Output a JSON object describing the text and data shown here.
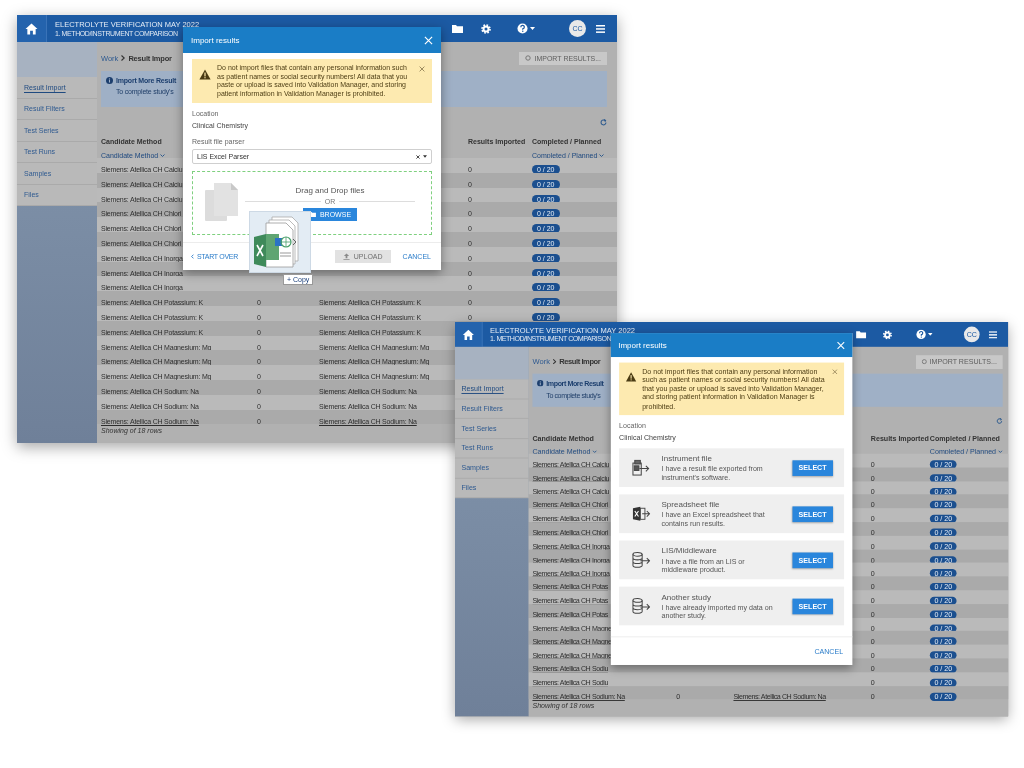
{
  "windows": [
    {
      "header": {
        "title": "ELECTROLYTE VERIFICATION MAY 2022",
        "subtitle": "1. METHOD/INSTRUMENT COMPARISON",
        "avatar": "CC"
      },
      "sidebar": [
        {
          "label": "Result Import",
          "selected": true
        },
        {
          "label": "Result Filters",
          "selected": false
        },
        {
          "label": "Test Series",
          "selected": false
        },
        {
          "label": "Test Runs",
          "selected": false
        },
        {
          "label": "Samples",
          "selected": false
        },
        {
          "label": "Files",
          "selected": false
        }
      ],
      "breadcrumb": {
        "parent": "Work",
        "current": "Result Impor"
      },
      "action_button": "IMPORT RESULTS...",
      "notice": {
        "title": "Import More Result",
        "text": "To complete study's"
      },
      "table": {
        "columns": {
          "column_1": {
            "label": "Candidate Method",
            "filter": "Candidate Method"
          },
          "column_4": {
            "label": "Results Imported"
          },
          "column_5": {
            "label": "Completed / Planned",
            "filter": "Completed / Planned"
          }
        },
        "rows": [
          {
            "column_1": "Siemens: Atellica CH Calciu",
            "column_4": "0",
            "column_5": "0 / 20"
          },
          {
            "column_1": "Siemens: Atellica CH Calciu",
            "column_4": "0",
            "column_5": "0 / 20"
          },
          {
            "column_1": "Siemens: Atellica CH Calciu",
            "column_4": "0",
            "column_5": "0 / 20"
          },
          {
            "column_1": "Siemens: Atellica CH Chlori",
            "column_4": "0",
            "column_5": "0 / 20"
          },
          {
            "column_1": "Siemens: Atellica CH Chlori",
            "column_4": "0",
            "column_5": "0 / 20"
          },
          {
            "column_1": "Siemens: Atellica CH Chlori",
            "column_4": "0",
            "column_5": "0 / 20"
          },
          {
            "column_1": "Siemens: Atellica CH Inorga",
            "column_4": "0",
            "column_5": "0 / 20"
          },
          {
            "column_1": "Siemens: Atellica CH Inorga",
            "column_4": "0",
            "column_5": "0 / 20"
          },
          {
            "column_1": "Siemens: Atellica CH Inorga",
            "column_4": "0",
            "column_5": "0 / 20"
          },
          {
            "column_1": "Siemens: Atellica CH Potassium: K",
            "column_2": "0",
            "column_3": "Siemens: Atellica CH Potassium: K",
            "column_4": "0",
            "column_5": "0 / 20"
          },
          {
            "column_1": "Siemens: Atellica CH Potassium: K",
            "column_2": "0",
            "column_3": "Siemens: Atellica CH Potassium: K",
            "column_4": "0",
            "column_5": "0 / 20"
          },
          {
            "column_1": "Siemens: Atellica CH Potassium: K",
            "column_2": "0",
            "column_3": "Siemens: Atellica CH Potassium: K"
          },
          {
            "column_1": "Siemens: Atellica CH Magnesium: Mg",
            "column_2": "0",
            "column_3": "Siemens: Atellica CH Magnesium: Mg"
          },
          {
            "column_1": "Siemens: Atellica CH Magnesium: Mg",
            "column_2": "0",
            "column_3": "Siemens: Atellica CH Magnesium: Mg"
          },
          {
            "column_1": "Siemens: Atellica CH Magnesium: Mg",
            "column_2": "0",
            "column_3": "Siemens: Atellica CH Magnesium: Mg"
          },
          {
            "column_1": "Siemens: Atellica CH Sodium: Na",
            "column_2": "0",
            "column_3": "Siemens: Atellica CH Sodium: Na"
          },
          {
            "column_1": "Siemens: Atellica CH Sodium: Na",
            "column_2": "0",
            "column_3": "Siemens: Atellica CH Sodium: Na"
          },
          {
            "column_1": "Siemens: Atellica CH Sodium: Na",
            "column_2": "0",
            "column_3": "Siemens: Atellica CH Sodium: Na"
          }
        ],
        "footer": "Showing of 18 rows"
      },
      "dialog": {
        "kind": "upload",
        "title": "Import results",
        "warning": "Do not import files that contain any personal information such as patient names or social security numbers! All data that you paste or upload is saved into Validation Manager, and storing patient information in Validation Manager is prohibited.",
        "location_label": "Location",
        "location": "Clinical Chemistry",
        "parser_label": "Result file parser",
        "parser": "LIS Excel Parser",
        "drop_text": "Drag and Drop files",
        "or_text": "OR",
        "browse": "BROWSE",
        "drag_hint": "+ Copy",
        "start_over": "START OVER",
        "upload": {
          "label": "UPLOAD",
          "disabled": true
        },
        "cancel": "CANCEL"
      }
    },
    {
      "header": {
        "title": "ELECTROLYTE VERIFICATION MAY 2022",
        "subtitle": "1. METHOD/INSTRUMENT COMPARISON",
        "avatar": "CC"
      },
      "sidebar": [
        {
          "label": "Result Import",
          "selected": true
        },
        {
          "label": "Result Filters",
          "selected": false
        },
        {
          "label": "Test Series",
          "selected": false
        },
        {
          "label": "Test Runs",
          "selected": false
        },
        {
          "label": "Samples",
          "selected": false
        },
        {
          "label": "Files",
          "selected": false
        }
      ],
      "breadcrumb": {
        "parent": "Work",
        "current": "Result Impor"
      },
      "action_button": "IMPORT RESULTS...",
      "notice": {
        "title": "Import More Result",
        "text": "To complete study's"
      },
      "table": {
        "columns": {
          "column_1": {
            "label": "Candidate Method",
            "filter": "Candidate Method"
          },
          "column_4": {
            "label": "Results Imported"
          },
          "column_5": {
            "label": "Completed / Planned",
            "filter": "Completed / Planned"
          }
        },
        "rows": [
          {
            "column_1": "Siemens: Atellica CH Calciu",
            "column_4": "0",
            "column_5": "0 / 20"
          },
          {
            "column_1": "Siemens: Atellica CH Calciu",
            "column_4": "0",
            "column_5": "0 / 20"
          },
          {
            "column_1": "Siemens: Atellica CH Calciu",
            "column_4": "0",
            "column_5": "0 / 20"
          },
          {
            "column_1": "Siemens: Atellica CH Chlori",
            "column_4": "0",
            "column_5": "0 / 20"
          },
          {
            "column_1": "Siemens: Atellica CH Chlori",
            "column_4": "0",
            "column_5": "0 / 20"
          },
          {
            "column_1": "Siemens: Atellica CH Chlori",
            "column_4": "0",
            "column_5": "0 / 20"
          },
          {
            "column_1": "Siemens: Atellica CH Inorga",
            "column_4": "0",
            "column_5": "0 / 20"
          },
          {
            "column_1": "Siemens: Atellica CH Inorga",
            "column_4": "0",
            "column_5": "0 / 20"
          },
          {
            "column_1": "Siemens: Atellica CH Inorga",
            "column_4": "0",
            "column_5": "0 / 20"
          },
          {
            "column_1": "Siemens: Atellica CH Potas",
            "column_4": "0",
            "column_5": "0 / 20"
          },
          {
            "column_1": "Siemens: Atellica CH Potas",
            "column_4": "0",
            "column_5": "0 / 20"
          },
          {
            "column_1": "Siemens: Atellica CH Potas",
            "column_4": "0",
            "column_5": "0 / 20"
          },
          {
            "column_1": "Siemens: Atellica CH Magne",
            "column_4": "0",
            "column_5": "0 / 20"
          },
          {
            "column_1": "Siemens: Atellica CH Magne",
            "column_4": "0",
            "column_5": "0 / 20"
          },
          {
            "column_1": "Siemens: Atellica CH Magne",
            "column_4": "0",
            "column_5": "0 / 20"
          },
          {
            "column_1": "Siemens: Atellica CH Sodiu",
            "column_4": "0",
            "column_5": "0 / 20"
          },
          {
            "column_1": "Siemens: Atellica CH Sodiu",
            "column_4": "0",
            "column_5": "0 / 20"
          },
          {
            "column_1": "Siemens: Atellica CH Sodium: Na",
            "column_2": "0",
            "column_3": "Siemens: Atellica CH Sodium: Na",
            "column_4": "0",
            "column_5": "0 / 20"
          }
        ],
        "footer": "Showing of 18 rows"
      },
      "dialog": {
        "kind": "choose",
        "title": "Import results",
        "warning": "Do not import files that contain any personal information such as patient names or social security numbers! All data that you paste or upload is saved into Validation Manager, and storing patient information in Validation Manager is prohibited.",
        "location_label": "Location",
        "location": "Clinical Chemistry",
        "options": [
          {
            "kind": "instrument",
            "title": "Instrument file",
            "text": "I have a result file exported from instrument's software.",
            "button": "SELECT"
          },
          {
            "kind": "spreadsheet",
            "title": "Spreadsheet file",
            "text": "I have an Excel spreadsheet that contains run results.",
            "button": "SELECT"
          },
          {
            "kind": "database",
            "title": "LIS/Middleware",
            "text": "I have a file from an LIS or middleware product.",
            "button": "SELECT"
          },
          {
            "kind": "database",
            "title": "Another study",
            "text": "I have already imported my data on another study.",
            "button": "SELECT"
          }
        ],
        "cancel": "CANCEL"
      }
    }
  ]
}
